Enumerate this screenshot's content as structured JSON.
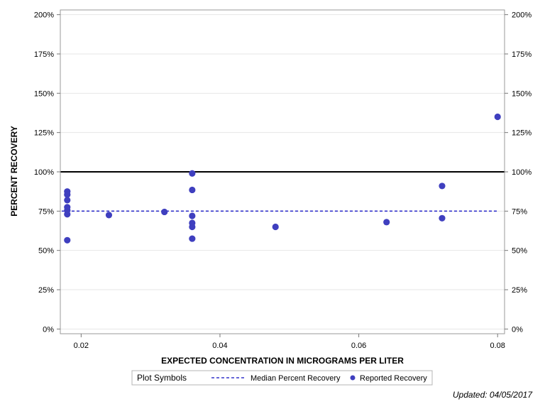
{
  "chart_data": {
    "type": "scatter",
    "xlabel": "EXPECTED CONCENTRATION IN MICROGRAMS PER LITER",
    "ylabel": "PERCENT RECOVERY",
    "xlim": [
      0.017,
      0.081
    ],
    "ylim": [
      -3,
      203
    ],
    "x_ticks": [
      0.02,
      0.04,
      0.06,
      0.08
    ],
    "x_tick_labels": [
      "0.02",
      "0.04",
      "0.06",
      "0.08"
    ],
    "y_ticks": [
      0,
      25,
      50,
      75,
      100,
      125,
      150,
      175,
      200
    ],
    "y_tick_labels": [
      "0%",
      "25%",
      "50%",
      "75%",
      "100%",
      "125%",
      "150%",
      "175%",
      "200%"
    ],
    "grid": true,
    "reference_line": {
      "y": 100,
      "color": "#000000"
    },
    "median_line": {
      "name": "Median Percent Recovery",
      "y": 75,
      "color": "#3333cc"
    },
    "series": [
      {
        "name": "Reported Recovery",
        "color": "#3f3fbf",
        "points": [
          {
            "x": 0.018,
            "y": 87.5
          },
          {
            "x": 0.018,
            "y": 85.5
          },
          {
            "x": 0.018,
            "y": 82
          },
          {
            "x": 0.018,
            "y": 77.5
          },
          {
            "x": 0.018,
            "y": 75.5
          },
          {
            "x": 0.018,
            "y": 73
          },
          {
            "x": 0.018,
            "y": 56.5
          },
          {
            "x": 0.024,
            "y": 72.5
          },
          {
            "x": 0.032,
            "y": 74.5
          },
          {
            "x": 0.036,
            "y": 99
          },
          {
            "x": 0.036,
            "y": 88.5
          },
          {
            "x": 0.036,
            "y": 72
          },
          {
            "x": 0.036,
            "y": 67.5
          },
          {
            "x": 0.036,
            "y": 65
          },
          {
            "x": 0.036,
            "y": 57.5
          },
          {
            "x": 0.048,
            "y": 65
          },
          {
            "x": 0.064,
            "y": 68
          },
          {
            "x": 0.072,
            "y": 91
          },
          {
            "x": 0.072,
            "y": 70.5
          },
          {
            "x": 0.08,
            "y": 135
          }
        ]
      }
    ]
  },
  "legend": {
    "title": "Plot Symbols",
    "items": [
      {
        "label": "Median Percent Recovery",
        "symbol": "dashed-line"
      },
      {
        "label": "Reported Recovery",
        "symbol": "dot"
      }
    ]
  },
  "footer": {
    "updated": "Updated: 04/05/2017"
  }
}
